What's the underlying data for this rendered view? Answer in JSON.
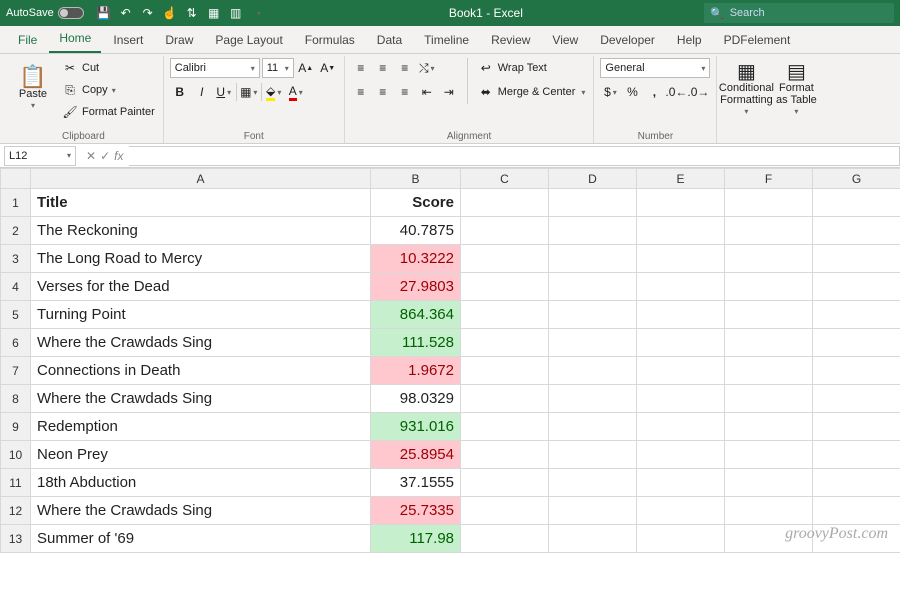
{
  "titlebar": {
    "autosave_label": "AutoSave",
    "autosave_state": "Off",
    "doc_title": "Book1 - Excel",
    "search_placeholder": "Search"
  },
  "tabs": [
    "File",
    "Home",
    "Insert",
    "Draw",
    "Page Layout",
    "Formulas",
    "Data",
    "Timeline",
    "Review",
    "View",
    "Developer",
    "Help",
    "PDFelement"
  ],
  "active_tab": "Home",
  "ribbon": {
    "clipboard": {
      "paste": "Paste",
      "cut": "Cut",
      "copy": "Copy",
      "painter": "Format Painter",
      "label": "Clipboard"
    },
    "font": {
      "name": "Calibri",
      "size": "11",
      "label": "Font"
    },
    "alignment": {
      "wrap": "Wrap Text",
      "merge": "Merge & Center",
      "label": "Alignment"
    },
    "number": {
      "format": "General",
      "label": "Number"
    },
    "styles": {
      "cond": "Conditional Formatting",
      "table": "Format as Table"
    }
  },
  "fbar": {
    "namebox": "L12",
    "formula": ""
  },
  "columns": [
    "A",
    "B",
    "C",
    "D",
    "E",
    "F",
    "G"
  ],
  "rows": [
    {
      "n": 1,
      "title": "Title",
      "score": "Score",
      "header": true
    },
    {
      "n": 2,
      "title": "The Reckoning",
      "score": "40.7875",
      "fmt": ""
    },
    {
      "n": 3,
      "title": "The Long Road to Mercy",
      "score": "10.3222",
      "fmt": "red"
    },
    {
      "n": 4,
      "title": "Verses for the Dead",
      "score": "27.9803",
      "fmt": "red"
    },
    {
      "n": 5,
      "title": "Turning Point",
      "score": "864.364",
      "fmt": "green"
    },
    {
      "n": 6,
      "title": "Where the Crawdads Sing",
      "score": "111.528",
      "fmt": "green"
    },
    {
      "n": 7,
      "title": "Connections in Death",
      "score": "1.9672",
      "fmt": "red"
    },
    {
      "n": 8,
      "title": "Where the Crawdads Sing",
      "score": "98.0329",
      "fmt": ""
    },
    {
      "n": 9,
      "title": "Redemption",
      "score": "931.016",
      "fmt": "green"
    },
    {
      "n": 10,
      "title": "Neon Prey",
      "score": "25.8954",
      "fmt": "red"
    },
    {
      "n": 11,
      "title": "18th Abduction",
      "score": "37.1555",
      "fmt": ""
    },
    {
      "n": 12,
      "title": "Where the Crawdads Sing",
      "score": "25.7335",
      "fmt": "red"
    },
    {
      "n": 13,
      "title": "Summer of '69",
      "score": "117.98",
      "fmt": "green"
    }
  ],
  "selected_row": 12,
  "watermark": "groovyPost.com"
}
